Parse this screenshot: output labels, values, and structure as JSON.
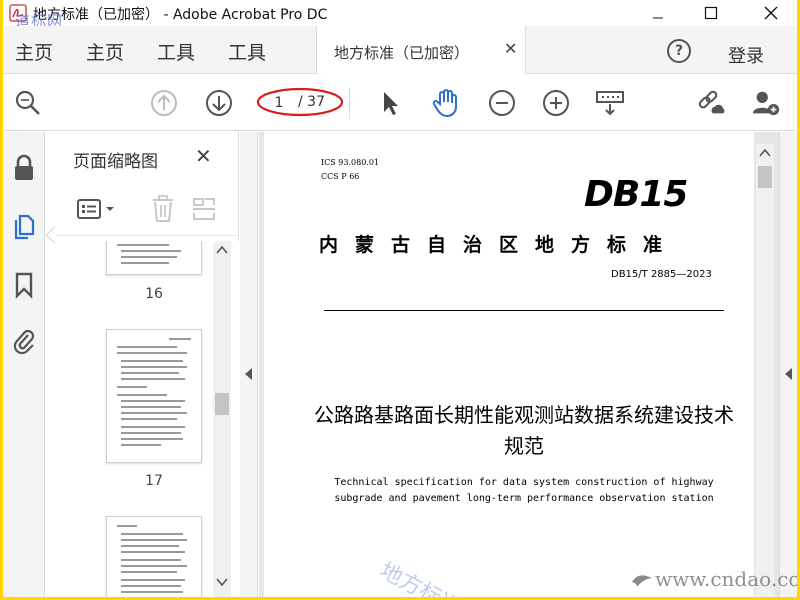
{
  "window": {
    "title": "地方标准（已加密） - Adobe Acrobat Pro DC",
    "watermark_topleft": "道标网"
  },
  "menu": {
    "items": [
      "主页",
      "主页",
      "工具",
      "工具"
    ],
    "doc_tab_title": "地方标准（已加密）",
    "login_label": "登录"
  },
  "toolbar": {
    "current_page": "1",
    "total_pages": "/ 37"
  },
  "thumbnails": {
    "title": "页面缩略图",
    "pages": [
      {
        "label": "16"
      },
      {
        "label": "17"
      },
      {
        "label": ""
      }
    ]
  },
  "document": {
    "ics": "ICS  93.080.01",
    "ccs": "CCS  P 66",
    "logo": "DB15",
    "standard_type": "内蒙古自治区地方标准",
    "standard_no": "DB15/T 2885—2023",
    "title_zh": "公路路基路面长期性能观测站数据系统建设技术规范",
    "title_en": "Technical specification for data system construction of highway subgrade and pavement long-term performance observation station"
  },
  "watermarks": {
    "diagonal": "地方标准",
    "site": "www.cndao.com"
  },
  "colors": {
    "border": "#ffd700",
    "highlight_oval": "#d81e1e",
    "active_blue": "#2c6fce"
  }
}
